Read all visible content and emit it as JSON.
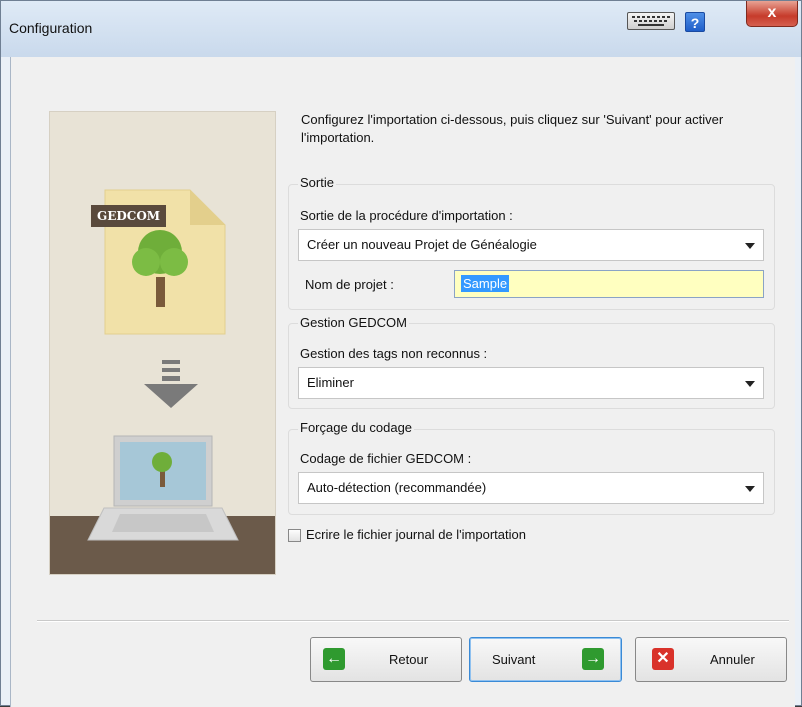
{
  "window": {
    "title": "Configuration",
    "help_label": "?",
    "close_label": "x"
  },
  "description": "Configurez l'importation ci-dessous, puis cliquez sur 'Suivant' pour activer l'importation.",
  "illustration": {
    "badge": "GEDCOM"
  },
  "sortie": {
    "legend": "Sortie",
    "output_label": "Sortie de la procédure d'importation :",
    "output_value": "Créer un nouveau Projet de Généalogie",
    "project_name_label": "Nom de projet :",
    "project_name_value": "Sample"
  },
  "gedcom": {
    "legend": "Gestion GEDCOM",
    "tags_label": "Gestion des tags non reconnus :",
    "tags_value": "Eliminer"
  },
  "encoding": {
    "legend": "Forçage du codage",
    "file_encoding_label": "Codage de fichier GEDCOM :",
    "file_encoding_value": "Auto-détection (recommandée)"
  },
  "log_checkbox": {
    "label": "Ecrire le fichier journal de l'importation",
    "checked": false
  },
  "buttons": {
    "back": "Retour",
    "next": "Suivant",
    "cancel": "Annuler"
  },
  "colors": {
    "accent_green": "#2f9a2f",
    "cancel_red": "#d9322a",
    "selection_blue": "#3399ff"
  }
}
